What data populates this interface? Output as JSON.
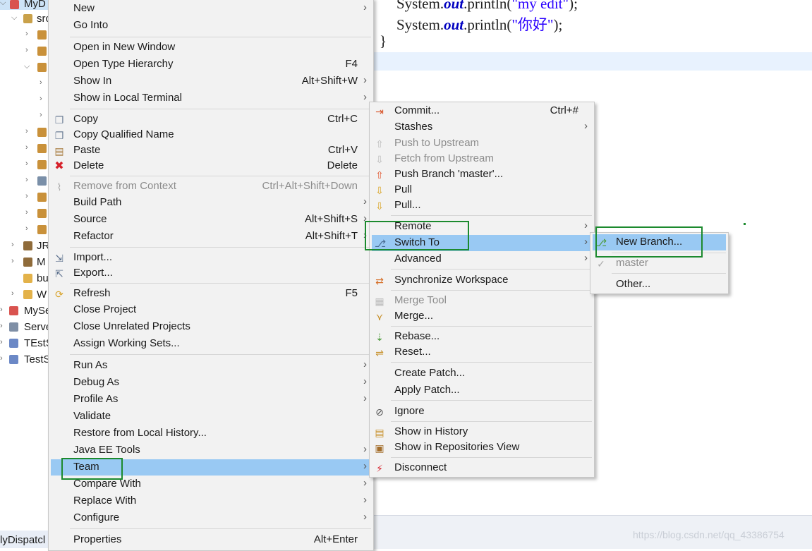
{
  "explorer": {
    "rows": [
      {
        "label": "MyD"
      },
      {
        "label": "src"
      },
      {
        "label": ""
      },
      {
        "label": ""
      },
      {
        "label": ""
      },
      {
        "label": "JR"
      },
      {
        "label": "M"
      },
      {
        "label": "bu"
      },
      {
        "label": "W"
      },
      {
        "label": "MySe"
      },
      {
        "label": "Serve"
      },
      {
        "label": "TEstS"
      },
      {
        "label": "TestS"
      }
    ],
    "status_label": "lyDispatcl"
  },
  "editor": {
    "line1_prefix": "System.",
    "line1_kw": "out",
    "line1_mid": ".println(",
    "line1_str": "\"my edit\"",
    "line1_end": ");",
    "line2_prefix": "System.",
    "line2_kw": "out",
    "line2_mid": ".println(",
    "line2_str": "\"你好\"",
    "line2_end": ");",
    "line3": "}",
    "watermark": "https://blog.csdn.net/qq_43386754"
  },
  "main_menu": {
    "items": [
      {
        "label": "New",
        "shortcut": "",
        "submenu": true
      },
      {
        "label": "Go Into",
        "shortcut": "",
        "submenu": false
      },
      {
        "label": "Open in New Window",
        "shortcut": "",
        "submenu": false
      },
      {
        "label": "Open Type Hierarchy",
        "shortcut": "F4",
        "submenu": false
      },
      {
        "label": "Show In",
        "shortcut": "Alt+Shift+W",
        "submenu": true
      },
      {
        "label": "Show in Local Terminal",
        "shortcut": "",
        "submenu": true
      },
      {
        "label": "Copy",
        "shortcut": "Ctrl+C",
        "submenu": false,
        "icon": "copy-icon"
      },
      {
        "label": "Copy Qualified Name",
        "shortcut": "",
        "submenu": false,
        "icon": "copy-qualified-icon"
      },
      {
        "label": "Paste",
        "shortcut": "Ctrl+V",
        "submenu": false,
        "icon": "paste-icon"
      },
      {
        "label": "Delete",
        "shortcut": "Delete",
        "submenu": false,
        "icon": "delete-icon"
      },
      {
        "label": "Remove from Context",
        "shortcut": "Ctrl+Alt+Shift+Down",
        "submenu": false,
        "disabled": true,
        "icon": "remove-context-icon"
      },
      {
        "label": "Build Path",
        "shortcut": "",
        "submenu": true
      },
      {
        "label": "Source",
        "shortcut": "Alt+Shift+S",
        "submenu": true
      },
      {
        "label": "Refactor",
        "shortcut": "Alt+Shift+T",
        "submenu": true
      },
      {
        "label": "Import...",
        "shortcut": "",
        "submenu": false,
        "icon": "import-icon"
      },
      {
        "label": "Export...",
        "shortcut": "",
        "submenu": false,
        "icon": "export-icon"
      },
      {
        "label": "Refresh",
        "shortcut": "F5",
        "submenu": false,
        "icon": "refresh-icon"
      },
      {
        "label": "Close Project",
        "shortcut": "",
        "submenu": false
      },
      {
        "label": "Close Unrelated Projects",
        "shortcut": "",
        "submenu": false
      },
      {
        "label": "Assign Working Sets...",
        "shortcut": "",
        "submenu": false
      },
      {
        "label": "Run As",
        "shortcut": "",
        "submenu": true
      },
      {
        "label": "Debug As",
        "shortcut": "",
        "submenu": true
      },
      {
        "label": "Profile As",
        "shortcut": "",
        "submenu": true
      },
      {
        "label": "Validate",
        "shortcut": "",
        "submenu": false
      },
      {
        "label": "Restore from Local History...",
        "shortcut": "",
        "submenu": false
      },
      {
        "label": "Java EE Tools",
        "shortcut": "",
        "submenu": true
      },
      {
        "label": "Team",
        "shortcut": "",
        "submenu": true,
        "highlighted": true
      },
      {
        "label": "Compare With",
        "shortcut": "",
        "submenu": true
      },
      {
        "label": "Replace With",
        "shortcut": "",
        "submenu": true
      },
      {
        "label": "Configure",
        "shortcut": "",
        "submenu": true
      },
      {
        "label": "Properties",
        "shortcut": "Alt+Enter",
        "submenu": false
      }
    ]
  },
  "team_menu": {
    "items": [
      {
        "label": "Commit...",
        "shortcut": "Ctrl+#",
        "submenu": false,
        "icon": "commit-icon"
      },
      {
        "label": "Stashes",
        "shortcut": "",
        "submenu": true
      },
      {
        "label": "Push to Upstream",
        "shortcut": "",
        "submenu": false,
        "disabled": true,
        "icon": "push-upstream-icon"
      },
      {
        "label": "Fetch from Upstream",
        "shortcut": "",
        "submenu": false,
        "disabled": true,
        "icon": "fetch-upstream-icon"
      },
      {
        "label": "Push Branch 'master'...",
        "shortcut": "",
        "submenu": false,
        "icon": "push-branch-icon"
      },
      {
        "label": "Pull",
        "shortcut": "",
        "submenu": false,
        "icon": "pull-icon"
      },
      {
        "label": "Pull...",
        "shortcut": "",
        "submenu": false,
        "icon": "pull-dialog-icon"
      },
      {
        "label": "Remote",
        "shortcut": "",
        "submenu": true
      },
      {
        "label": "Switch To",
        "shortcut": "",
        "submenu": true,
        "highlighted": true,
        "icon": "switch-to-icon"
      },
      {
        "label": "Advanced",
        "shortcut": "",
        "submenu": true
      },
      {
        "label": "Synchronize Workspace",
        "shortcut": "",
        "submenu": false,
        "icon": "synchronize-icon"
      },
      {
        "label": "Merge Tool",
        "shortcut": "",
        "submenu": false,
        "disabled": true,
        "icon": "merge-tool-icon"
      },
      {
        "label": "Merge...",
        "shortcut": "",
        "submenu": false,
        "icon": "merge-icon"
      },
      {
        "label": "Rebase...",
        "shortcut": "",
        "submenu": false,
        "icon": "rebase-icon"
      },
      {
        "label": "Reset...",
        "shortcut": "",
        "submenu": false,
        "icon": "reset-icon"
      },
      {
        "label": "Create Patch...",
        "shortcut": "",
        "submenu": false
      },
      {
        "label": "Apply Patch...",
        "shortcut": "",
        "submenu": false
      },
      {
        "label": "Ignore",
        "shortcut": "",
        "submenu": false,
        "icon": "ignore-icon"
      },
      {
        "label": "Show in History",
        "shortcut": "",
        "submenu": false,
        "icon": "history-icon"
      },
      {
        "label": "Show in Repositories View",
        "shortcut": "",
        "submenu": false,
        "icon": "repositories-icon"
      },
      {
        "label": "Disconnect",
        "shortcut": "",
        "submenu": false,
        "icon": "disconnect-icon"
      }
    ]
  },
  "switch_menu": {
    "items": [
      {
        "label": "New Branch...",
        "highlighted": true,
        "icon": "new-branch-icon"
      },
      {
        "label": "master",
        "disabled": true,
        "icon": "branch-checked-icon"
      },
      {
        "label": "Other...",
        "disabled": false
      }
    ]
  },
  "colors": {
    "highlight": "#99c9f3",
    "menu_bg": "#f2f2f2",
    "annotation_box": "#1c8a2e",
    "keyword": "#0000c0",
    "string": "#2a00ff"
  }
}
